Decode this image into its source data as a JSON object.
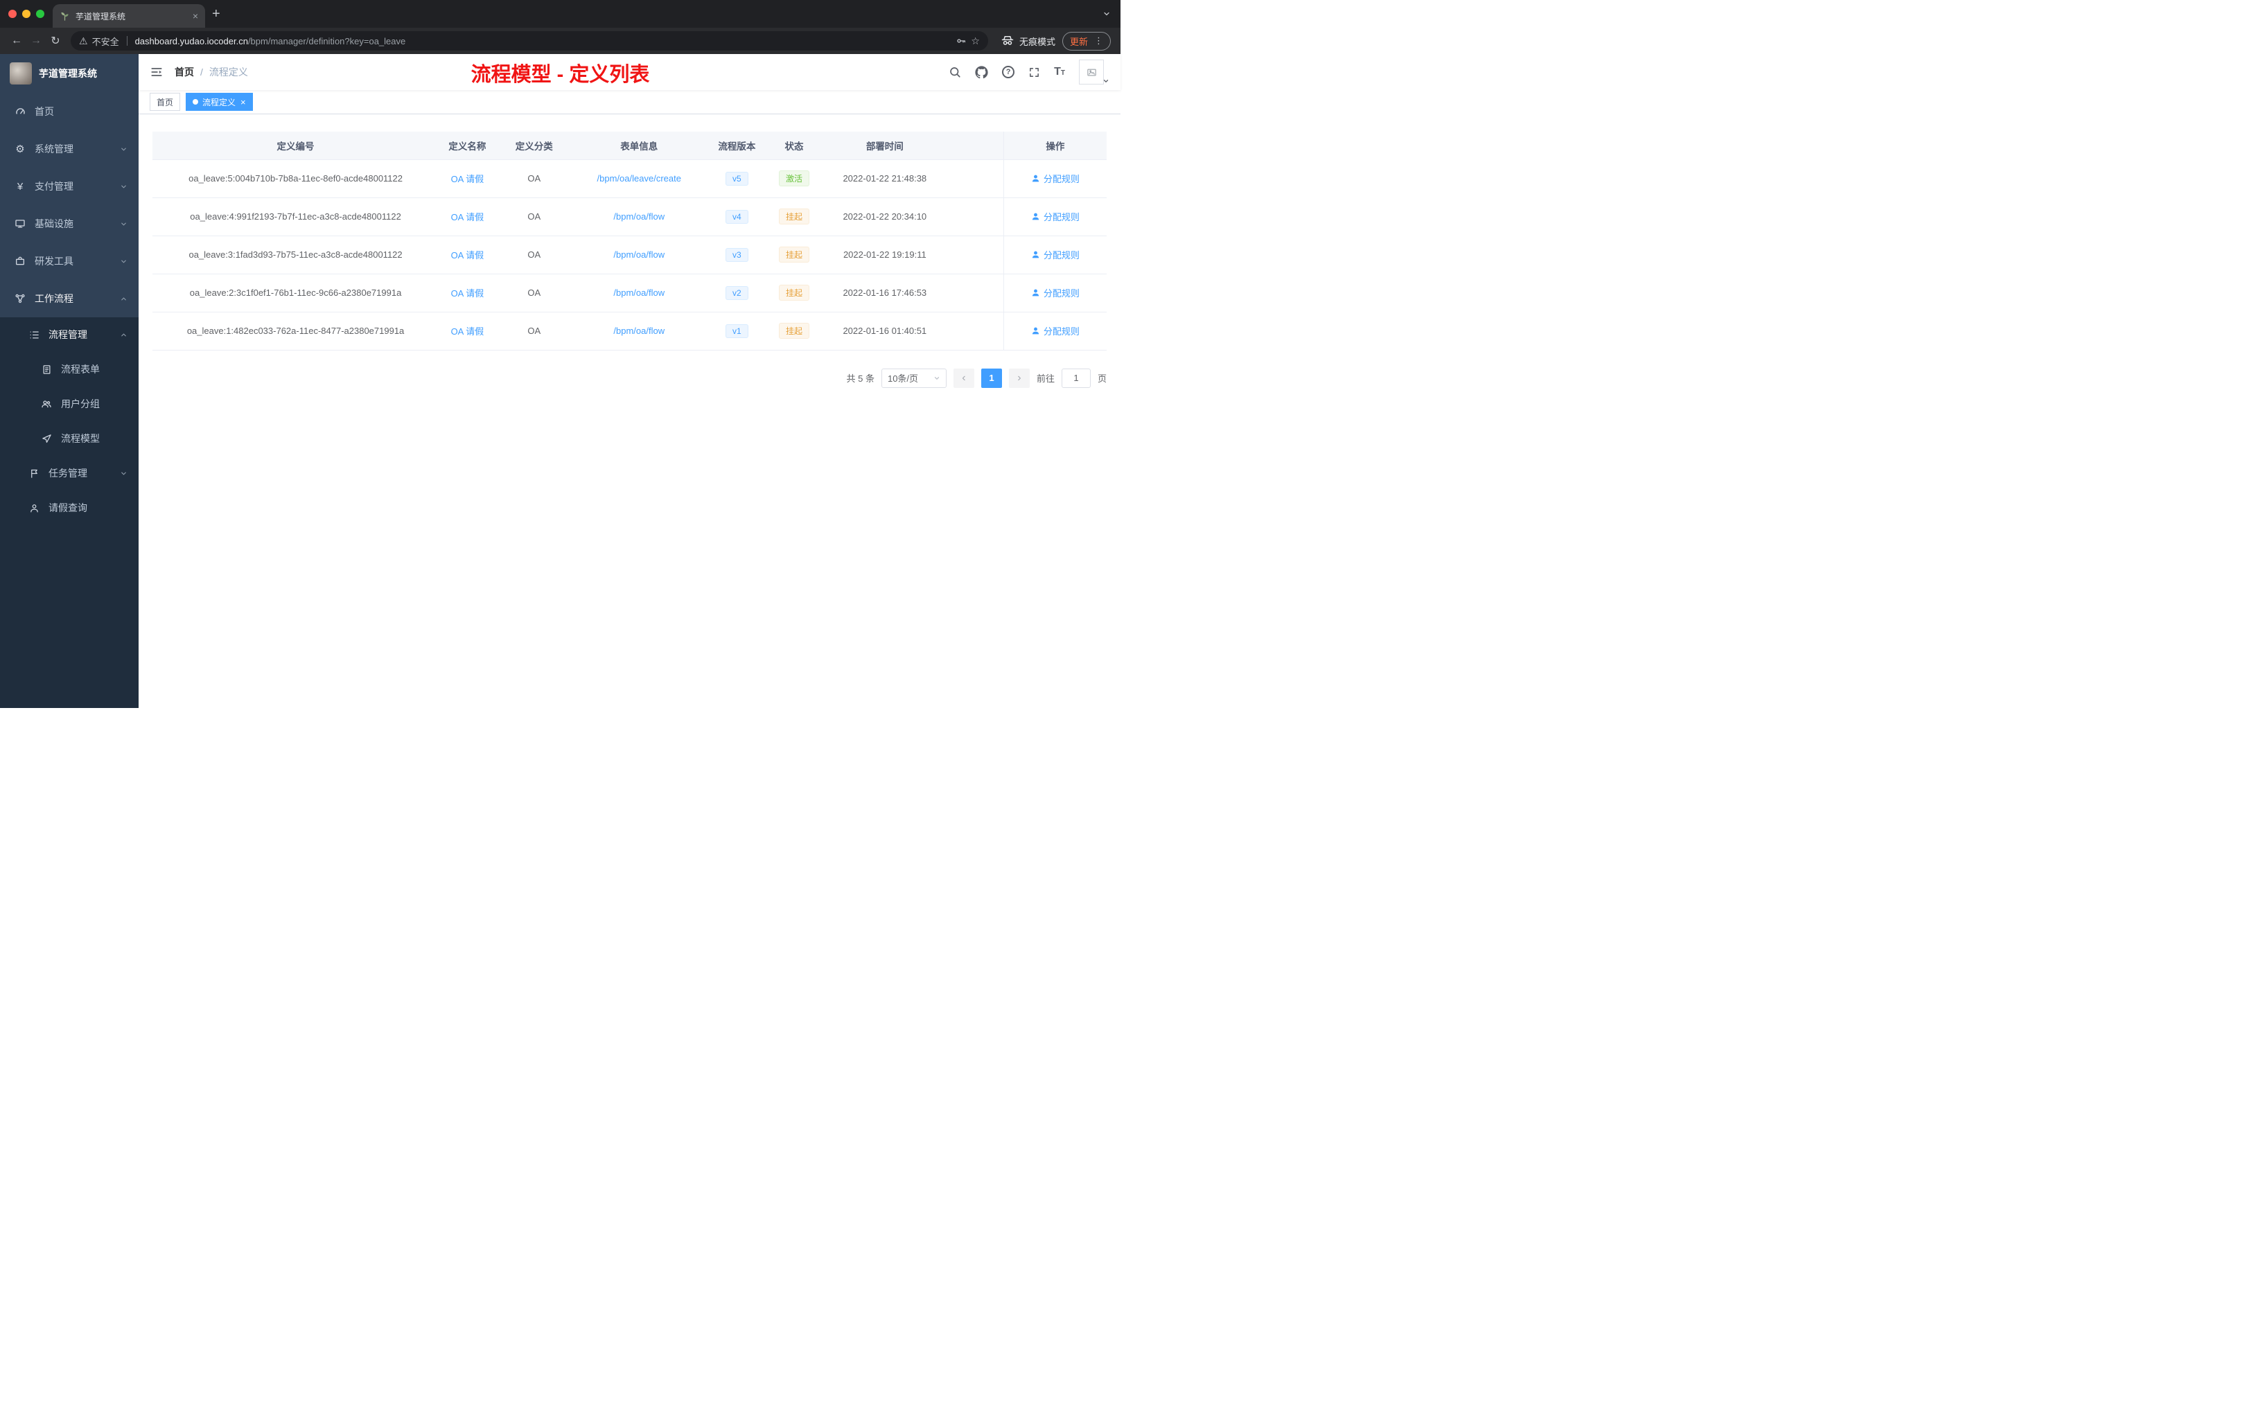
{
  "browser": {
    "tab_title": "芋道管理系统",
    "security_label": "不安全",
    "url_host": "dashboard.yudao.iocoder.cn",
    "url_path": "/bpm/manager/definition?key=oa_leave",
    "incognito_label": "无痕模式",
    "update_label": "更新"
  },
  "icons": {
    "back": "←",
    "forward": "→",
    "reload": "↻",
    "warning": "⚠",
    "star": "☆",
    "kebab": "⋮",
    "gear": "⚙",
    "yen": "¥",
    "close": "×",
    "plus": "+",
    "prev": "‹",
    "next": "›"
  },
  "sidebar": {
    "logo_title": "芋道管理系统",
    "items": [
      {
        "label": "首页"
      },
      {
        "label": "系统管理"
      },
      {
        "label": "支付管理"
      },
      {
        "label": "基础设施"
      },
      {
        "label": "研发工具"
      },
      {
        "label": "工作流程"
      }
    ],
    "submenu": {
      "process": {
        "label": "流程管理"
      },
      "children": [
        {
          "label": "流程表单"
        },
        {
          "label": "用户分组"
        },
        {
          "label": "流程模型"
        }
      ],
      "task": {
        "label": "任务管理"
      },
      "leave": {
        "label": "请假查询"
      }
    }
  },
  "header": {
    "breadcrumb_home": "首页",
    "breadcrumb_sep": "/",
    "breadcrumb_current": "流程定义",
    "annotation": "流程模型 - 定义列表"
  },
  "tags": [
    {
      "label": "首页"
    },
    {
      "label": "流程定义"
    }
  ],
  "table": {
    "columns": [
      "定义编号",
      "定义名称",
      "定义分类",
      "表单信息",
      "流程版本",
      "状态",
      "部署时间",
      "操作"
    ],
    "rows": [
      {
        "id": "oa_leave:5:004b710b-7b8a-11ec-8ef0-acde48001122",
        "name": "OA 请假",
        "category": "OA",
        "form": "/bpm/oa/leave/create",
        "version": "v5",
        "status": "激活",
        "status_type": "success",
        "deploy_time": "2022-01-22 21:48:38",
        "action": "分配规则"
      },
      {
        "id": "oa_leave:4:991f2193-7b7f-11ec-a3c8-acde48001122",
        "name": "OA 请假",
        "category": "OA",
        "form": "/bpm/oa/flow",
        "version": "v4",
        "status": "挂起",
        "status_type": "warning",
        "deploy_time": "2022-01-22 20:34:10",
        "action": "分配规则"
      },
      {
        "id": "oa_leave:3:1fad3d93-7b75-11ec-a3c8-acde48001122",
        "name": "OA 请假",
        "category": "OA",
        "form": "/bpm/oa/flow",
        "version": "v3",
        "status": "挂起",
        "status_type": "warning",
        "deploy_time": "2022-01-22 19:19:11",
        "action": "分配规则"
      },
      {
        "id": "oa_leave:2:3c1f0ef1-76b1-11ec-9c66-a2380e71991a",
        "name": "OA 请假",
        "category": "OA",
        "form": "/bpm/oa/flow",
        "version": "v2",
        "status": "挂起",
        "status_type": "warning",
        "deploy_time": "2022-01-16 17:46:53",
        "action": "分配规则"
      },
      {
        "id": "oa_leave:1:482ec033-762a-11ec-8477-a2380e71991a",
        "name": "OA 请假",
        "category": "OA",
        "form": "/bpm/oa/flow",
        "version": "v1",
        "status": "挂起",
        "status_type": "warning",
        "deploy_time": "2022-01-16 01:40:51",
        "action": "分配规则"
      }
    ]
  },
  "pagination": {
    "total": "共 5 条",
    "page_size": "10条/页",
    "page": "1",
    "goto_label": "前往",
    "goto_value": "1",
    "unit": "页"
  },
  "colors": {
    "accent": "#409eff",
    "annotation_red": "#f01414",
    "status_success": "#67c23a",
    "status_warning": "#e6a23c",
    "sidebar_bg": "#304156",
    "submenu_bg": "#1f2d3d"
  }
}
